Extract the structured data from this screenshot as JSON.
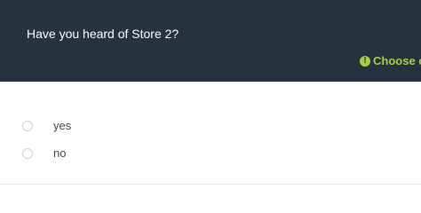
{
  "question": {
    "text": "Have you heard of Store 2?"
  },
  "hint": {
    "icon": "exclamation-circle-icon",
    "text": "Choose o"
  },
  "options": [
    {
      "label": "yes",
      "selected": false
    },
    {
      "label": "no",
      "selected": false
    }
  ],
  "colors": {
    "header_bg": "#28323f",
    "question_text": "#ffffff",
    "hint_accent": "#a8cf45",
    "option_text": "#444444",
    "radio_border": "#d0d0d0"
  }
}
